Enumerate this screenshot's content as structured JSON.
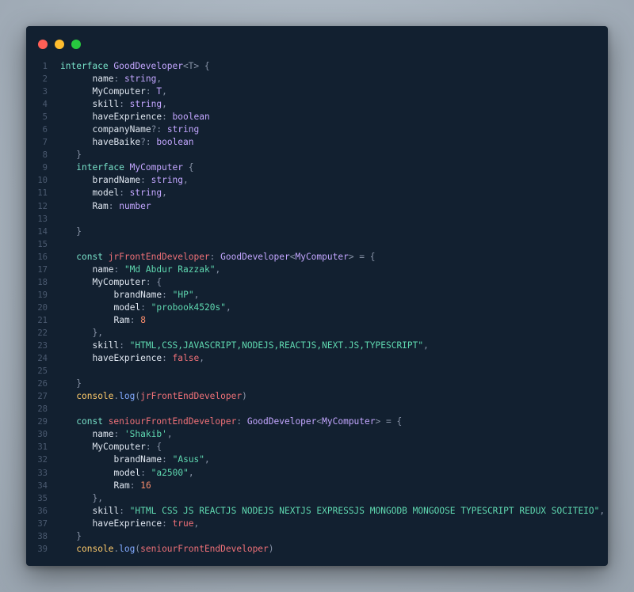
{
  "window": {
    "controls": [
      {
        "name": "close",
        "color": "#ff5f56"
      },
      {
        "name": "minimize",
        "color": "#ffbd2e"
      },
      {
        "name": "maximize",
        "color": "#27c93f"
      }
    ]
  },
  "code": {
    "lines": [
      {
        "n": "1",
        "indent": 0,
        "tokens": [
          [
            "kw",
            "interface"
          ],
          [
            "p",
            " "
          ],
          [
            "type",
            "GoodDeveloper"
          ],
          [
            "punct",
            "<T>"
          ],
          [
            "p",
            " "
          ],
          [
            "punct",
            "{"
          ]
        ]
      },
      {
        "n": "2",
        "indent": 6,
        "tokens": [
          [
            "prop",
            "name"
          ],
          [
            "punct",
            ": "
          ],
          [
            "type",
            "string"
          ],
          [
            "punct",
            ","
          ]
        ]
      },
      {
        "n": "3",
        "indent": 6,
        "tokens": [
          [
            "prop",
            "MyComputer"
          ],
          [
            "punct",
            ": "
          ],
          [
            "type",
            "T"
          ],
          [
            "punct",
            ","
          ]
        ]
      },
      {
        "n": "4",
        "indent": 6,
        "tokens": [
          [
            "prop",
            "skill"
          ],
          [
            "punct",
            ": "
          ],
          [
            "type",
            "string"
          ],
          [
            "punct",
            ","
          ]
        ]
      },
      {
        "n": "5",
        "indent": 6,
        "tokens": [
          [
            "prop",
            "haveExprience"
          ],
          [
            "punct",
            ": "
          ],
          [
            "type",
            "boolean"
          ]
        ]
      },
      {
        "n": "6",
        "indent": 6,
        "tokens": [
          [
            "prop",
            "companyName"
          ],
          [
            "punct",
            "?: "
          ],
          [
            "type",
            "string"
          ]
        ]
      },
      {
        "n": "7",
        "indent": 6,
        "tokens": [
          [
            "prop",
            "haveBaike"
          ],
          [
            "punct",
            "?: "
          ],
          [
            "type",
            "boolean"
          ]
        ]
      },
      {
        "n": "8",
        "indent": 3,
        "tokens": [
          [
            "punct",
            "}"
          ]
        ]
      },
      {
        "n": "9",
        "indent": 3,
        "tokens": [
          [
            "kw",
            "interface"
          ],
          [
            "p",
            " "
          ],
          [
            "type",
            "MyComputer"
          ],
          [
            "p",
            " "
          ],
          [
            "punct",
            "{"
          ]
        ]
      },
      {
        "n": "10",
        "indent": 6,
        "tokens": [
          [
            "prop",
            "brandName"
          ],
          [
            "punct",
            ": "
          ],
          [
            "type",
            "string"
          ],
          [
            "punct",
            ","
          ]
        ]
      },
      {
        "n": "11",
        "indent": 6,
        "tokens": [
          [
            "prop",
            "model"
          ],
          [
            "punct",
            ": "
          ],
          [
            "type",
            "string"
          ],
          [
            "punct",
            ","
          ]
        ]
      },
      {
        "n": "12",
        "indent": 6,
        "tokens": [
          [
            "prop",
            "Ram"
          ],
          [
            "punct",
            ": "
          ],
          [
            "type",
            "number"
          ]
        ]
      },
      {
        "n": "13",
        "indent": 0,
        "tokens": []
      },
      {
        "n": "14",
        "indent": 3,
        "tokens": [
          [
            "punct",
            "}"
          ]
        ]
      },
      {
        "n": "15",
        "indent": 0,
        "tokens": []
      },
      {
        "n": "16",
        "indent": 3,
        "tokens": [
          [
            "kw",
            "const"
          ],
          [
            "p",
            " "
          ],
          [
            "var",
            "jrFrontEndDeveloper"
          ],
          [
            "punct",
            ": "
          ],
          [
            "type",
            "GoodDeveloper"
          ],
          [
            "punct",
            "<"
          ],
          [
            "type",
            "MyComputer"
          ],
          [
            "punct",
            "> = {"
          ]
        ]
      },
      {
        "n": "17",
        "indent": 6,
        "tokens": [
          [
            "prop",
            "name"
          ],
          [
            "punct",
            ": "
          ],
          [
            "str",
            "\"Md Abdur Razzak\""
          ],
          [
            "punct",
            ","
          ]
        ]
      },
      {
        "n": "18",
        "indent": 6,
        "tokens": [
          [
            "prop",
            "MyComputer"
          ],
          [
            "punct",
            ": {"
          ]
        ]
      },
      {
        "n": "19",
        "indent": 10,
        "tokens": [
          [
            "prop",
            "brandName"
          ],
          [
            "punct",
            ": "
          ],
          [
            "str",
            "\"HP\""
          ],
          [
            "punct",
            ","
          ]
        ]
      },
      {
        "n": "20",
        "indent": 10,
        "tokens": [
          [
            "prop",
            "model"
          ],
          [
            "punct",
            ": "
          ],
          [
            "str",
            "\"probook4520s\""
          ],
          [
            "punct",
            ","
          ]
        ]
      },
      {
        "n": "21",
        "indent": 10,
        "tokens": [
          [
            "prop",
            "Ram"
          ],
          [
            "punct",
            ": "
          ],
          [
            "num",
            "8"
          ]
        ]
      },
      {
        "n": "22",
        "indent": 6,
        "tokens": [
          [
            "punct",
            "},"
          ]
        ]
      },
      {
        "n": "23",
        "indent": 6,
        "tokens": [
          [
            "prop",
            "skill"
          ],
          [
            "punct",
            ": "
          ],
          [
            "str",
            "\"HTML,CSS,JAVASCRIPT,NODEJS,REACTJS,NEXT.JS,TYPESCRIPT\""
          ],
          [
            "punct",
            ","
          ]
        ]
      },
      {
        "n": "24",
        "indent": 6,
        "tokens": [
          [
            "prop",
            "haveExprience"
          ],
          [
            "punct",
            ": "
          ],
          [
            "bool",
            "false"
          ],
          [
            "punct",
            ","
          ]
        ]
      },
      {
        "n": "25",
        "indent": 0,
        "tokens": []
      },
      {
        "n": "26",
        "indent": 3,
        "tokens": [
          [
            "punct",
            "}"
          ]
        ]
      },
      {
        "n": "27",
        "indent": 3,
        "tokens": [
          [
            "obj",
            "console"
          ],
          [
            "punct",
            "."
          ],
          [
            "fn",
            "log"
          ],
          [
            "punct",
            "("
          ],
          [
            "var",
            "jrFrontEndDeveloper"
          ],
          [
            "punct",
            ")"
          ]
        ]
      },
      {
        "n": "28",
        "indent": 0,
        "tokens": []
      },
      {
        "n": "29",
        "indent": 3,
        "tokens": [
          [
            "kw",
            "const"
          ],
          [
            "p",
            " "
          ],
          [
            "var",
            "seniourFrontEndDeveloper"
          ],
          [
            "punct",
            ": "
          ],
          [
            "type",
            "GoodDeveloper"
          ],
          [
            "punct",
            "<"
          ],
          [
            "type",
            "MyComputer"
          ],
          [
            "punct",
            "> = {"
          ]
        ]
      },
      {
        "n": "30",
        "indent": 6,
        "tokens": [
          [
            "prop",
            "name"
          ],
          [
            "punct",
            ": "
          ],
          [
            "str",
            "'Shakib'"
          ],
          [
            "punct",
            ","
          ]
        ]
      },
      {
        "n": "31",
        "indent": 6,
        "tokens": [
          [
            "prop",
            "MyComputer"
          ],
          [
            "punct",
            ": {"
          ]
        ]
      },
      {
        "n": "32",
        "indent": 10,
        "tokens": [
          [
            "prop",
            "brandName"
          ],
          [
            "punct",
            ": "
          ],
          [
            "str",
            "\"Asus\""
          ],
          [
            "punct",
            ","
          ]
        ]
      },
      {
        "n": "33",
        "indent": 10,
        "tokens": [
          [
            "prop",
            "model"
          ],
          [
            "punct",
            ": "
          ],
          [
            "str",
            "\"a2500\""
          ],
          [
            "punct",
            ","
          ]
        ]
      },
      {
        "n": "34",
        "indent": 10,
        "tokens": [
          [
            "prop",
            "Ram"
          ],
          [
            "punct",
            ": "
          ],
          [
            "num",
            "16"
          ]
        ]
      },
      {
        "n": "35",
        "indent": 6,
        "tokens": [
          [
            "punct",
            "},"
          ]
        ]
      },
      {
        "n": "36",
        "indent": 6,
        "tokens": [
          [
            "prop",
            "skill"
          ],
          [
            "punct",
            ": "
          ],
          [
            "str",
            "\"HTML CSS JS REACTJS NODEJS NEXTJS EXPRESSJS MONGODB MONGOOSE TYPESCRIPT REDUX SOCITEIO\""
          ],
          [
            "punct",
            ","
          ]
        ]
      },
      {
        "n": "37",
        "indent": 6,
        "tokens": [
          [
            "prop",
            "haveExprience"
          ],
          [
            "punct",
            ": "
          ],
          [
            "bool",
            "true"
          ],
          [
            "punct",
            ","
          ]
        ]
      },
      {
        "n": "38",
        "indent": 3,
        "tokens": [
          [
            "punct",
            "}"
          ]
        ]
      },
      {
        "n": "39",
        "indent": 3,
        "tokens": [
          [
            "obj",
            "console"
          ],
          [
            "punct",
            "."
          ],
          [
            "fn",
            "log"
          ],
          [
            "punct",
            "("
          ],
          [
            "var",
            "seniourFrontEndDeveloper"
          ],
          [
            "punct",
            ")"
          ]
        ]
      }
    ]
  }
}
